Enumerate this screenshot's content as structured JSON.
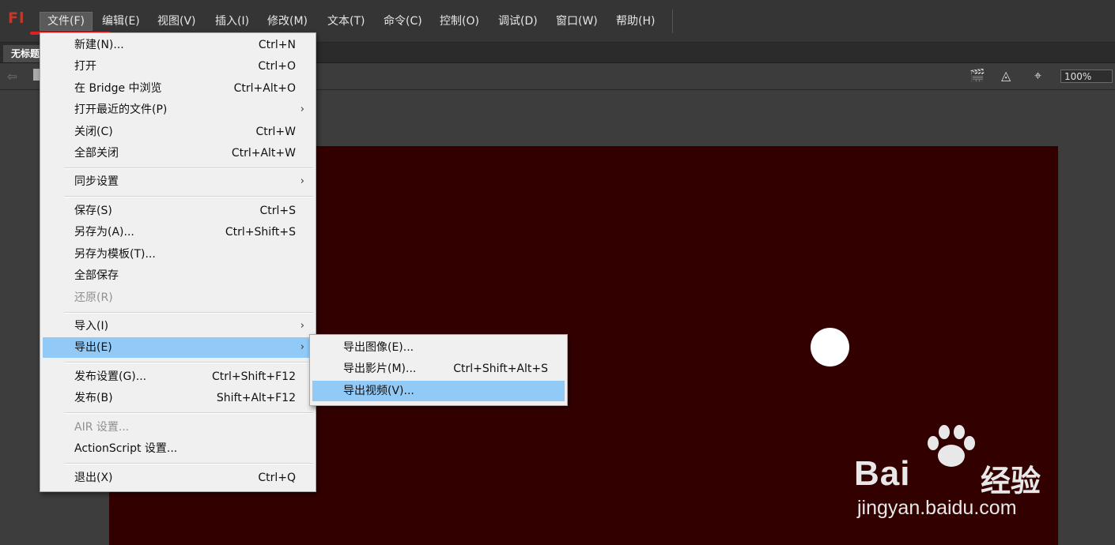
{
  "app": {
    "logo": "Fl"
  },
  "menubar": {
    "items": [
      "文件(F)",
      "编辑(E)",
      "视图(V)",
      "插入(I)",
      "修改(M)",
      "文本(T)",
      "命令(C)",
      "控制(O)",
      "调试(D)",
      "窗口(W)",
      "帮助(H)"
    ]
  },
  "document": {
    "tab_title": "无标题"
  },
  "toolbar": {
    "zoom": "100%"
  },
  "file_menu": {
    "items": [
      {
        "label": "新建(N)...",
        "shortcut": "Ctrl+N"
      },
      {
        "label": "打开",
        "shortcut": "Ctrl+O"
      },
      {
        "label": "在 Bridge 中浏览",
        "shortcut": "Ctrl+Alt+O"
      },
      {
        "label": "打开最近的文件(P)",
        "shortcut": "›"
      },
      {
        "label": "关闭(C)",
        "shortcut": "Ctrl+W"
      },
      {
        "label": "全部关闭",
        "shortcut": "Ctrl+Alt+W"
      },
      {
        "label": "同步设置",
        "shortcut": "›"
      },
      {
        "label": "保存(S)",
        "shortcut": "Ctrl+S"
      },
      {
        "label": "另存为(A)...",
        "shortcut": "Ctrl+Shift+S"
      },
      {
        "label": "另存为模板(T)...",
        "shortcut": ""
      },
      {
        "label": "全部保存",
        "shortcut": ""
      },
      {
        "label": "还原(R)",
        "shortcut": ""
      },
      {
        "label": "导入(I)",
        "shortcut": "›"
      },
      {
        "label": "导出(E)",
        "shortcut": "›"
      },
      {
        "label": "发布设置(G)...",
        "shortcut": "Ctrl+Shift+F12"
      },
      {
        "label": "发布(B)",
        "shortcut": "Shift+Alt+F12"
      },
      {
        "label": "AIR 设置...",
        "shortcut": ""
      },
      {
        "label": "ActionScript 设置...",
        "shortcut": ""
      },
      {
        "label": "退出(X)",
        "shortcut": "Ctrl+Q"
      }
    ]
  },
  "export_submenu": {
    "items": [
      {
        "label": "导出图像(E)...",
        "shortcut": ""
      },
      {
        "label": "导出影片(M)...",
        "shortcut": "Ctrl+Shift+Alt+S"
      },
      {
        "label": "导出视频(V)...",
        "shortcut": ""
      }
    ]
  },
  "watermark": {
    "brand": "Bai",
    "brand_suffix": "经验",
    "url": "jingyan.baidu.com"
  },
  "colors": {
    "stage": "#330000",
    "highlight": "#91c9f7",
    "underline": "#e02020"
  }
}
